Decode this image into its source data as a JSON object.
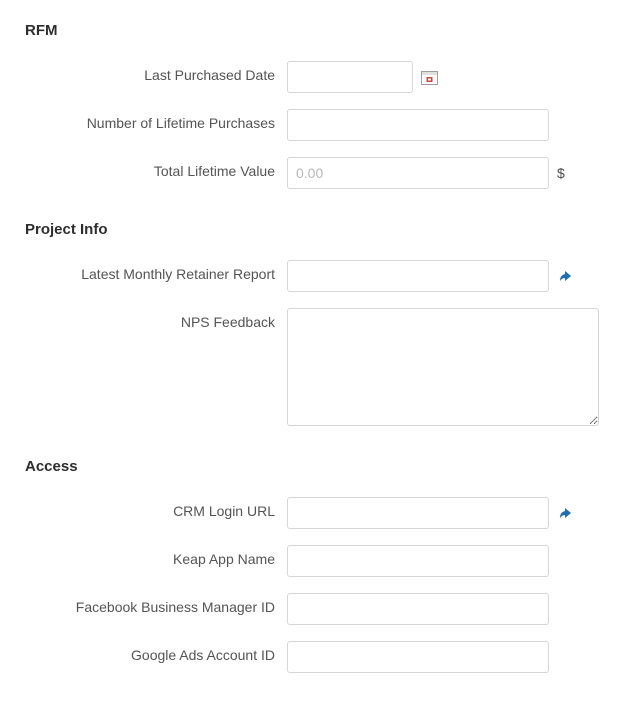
{
  "sections": {
    "rfm": {
      "title": "RFM",
      "fields": {
        "last_purchased_date": {
          "label": "Last Purchased Date",
          "value": ""
        },
        "lifetime_purchases": {
          "label": "Number of Lifetime Purchases",
          "value": ""
        },
        "total_lifetime_value": {
          "label": "Total Lifetime Value",
          "placeholder": "0.00",
          "value": "",
          "suffix": "$"
        }
      }
    },
    "project_info": {
      "title": "Project Info",
      "fields": {
        "retainer_report": {
          "label": "Latest Monthly Retainer Report",
          "value": ""
        },
        "nps_feedback": {
          "label": "NPS Feedback",
          "value": ""
        }
      }
    },
    "access": {
      "title": "Access",
      "fields": {
        "crm_login_url": {
          "label": "CRM Login URL",
          "value": ""
        },
        "keap_app_name": {
          "label": "Keap App Name",
          "value": ""
        },
        "fb_business_manager_id": {
          "label": "Facebook Business Manager ID",
          "value": ""
        },
        "google_ads_account_id": {
          "label": "Google Ads Account ID",
          "value": ""
        }
      }
    }
  }
}
